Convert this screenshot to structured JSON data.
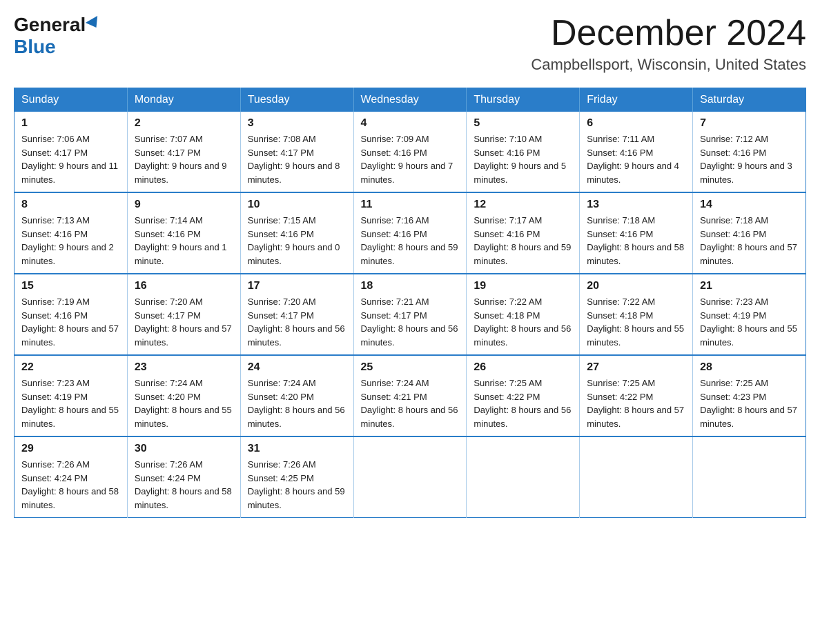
{
  "logo": {
    "general": "General",
    "blue": "Blue"
  },
  "header": {
    "month": "December 2024",
    "location": "Campbellsport, Wisconsin, United States"
  },
  "weekdays": [
    "Sunday",
    "Monday",
    "Tuesday",
    "Wednesday",
    "Thursday",
    "Friday",
    "Saturday"
  ],
  "weeks": [
    [
      {
        "day": "1",
        "sunrise": "7:06 AM",
        "sunset": "4:17 PM",
        "daylight": "9 hours and 11 minutes."
      },
      {
        "day": "2",
        "sunrise": "7:07 AM",
        "sunset": "4:17 PM",
        "daylight": "9 hours and 9 minutes."
      },
      {
        "day": "3",
        "sunrise": "7:08 AM",
        "sunset": "4:17 PM",
        "daylight": "9 hours and 8 minutes."
      },
      {
        "day": "4",
        "sunrise": "7:09 AM",
        "sunset": "4:16 PM",
        "daylight": "9 hours and 7 minutes."
      },
      {
        "day": "5",
        "sunrise": "7:10 AM",
        "sunset": "4:16 PM",
        "daylight": "9 hours and 5 minutes."
      },
      {
        "day": "6",
        "sunrise": "7:11 AM",
        "sunset": "4:16 PM",
        "daylight": "9 hours and 4 minutes."
      },
      {
        "day": "7",
        "sunrise": "7:12 AM",
        "sunset": "4:16 PM",
        "daylight": "9 hours and 3 minutes."
      }
    ],
    [
      {
        "day": "8",
        "sunrise": "7:13 AM",
        "sunset": "4:16 PM",
        "daylight": "9 hours and 2 minutes."
      },
      {
        "day": "9",
        "sunrise": "7:14 AM",
        "sunset": "4:16 PM",
        "daylight": "9 hours and 1 minute."
      },
      {
        "day": "10",
        "sunrise": "7:15 AM",
        "sunset": "4:16 PM",
        "daylight": "9 hours and 0 minutes."
      },
      {
        "day": "11",
        "sunrise": "7:16 AM",
        "sunset": "4:16 PM",
        "daylight": "8 hours and 59 minutes."
      },
      {
        "day": "12",
        "sunrise": "7:17 AM",
        "sunset": "4:16 PM",
        "daylight": "8 hours and 59 minutes."
      },
      {
        "day": "13",
        "sunrise": "7:18 AM",
        "sunset": "4:16 PM",
        "daylight": "8 hours and 58 minutes."
      },
      {
        "day": "14",
        "sunrise": "7:18 AM",
        "sunset": "4:16 PM",
        "daylight": "8 hours and 57 minutes."
      }
    ],
    [
      {
        "day": "15",
        "sunrise": "7:19 AM",
        "sunset": "4:16 PM",
        "daylight": "8 hours and 57 minutes."
      },
      {
        "day": "16",
        "sunrise": "7:20 AM",
        "sunset": "4:17 PM",
        "daylight": "8 hours and 57 minutes."
      },
      {
        "day": "17",
        "sunrise": "7:20 AM",
        "sunset": "4:17 PM",
        "daylight": "8 hours and 56 minutes."
      },
      {
        "day": "18",
        "sunrise": "7:21 AM",
        "sunset": "4:17 PM",
        "daylight": "8 hours and 56 minutes."
      },
      {
        "day": "19",
        "sunrise": "7:22 AM",
        "sunset": "4:18 PM",
        "daylight": "8 hours and 56 minutes."
      },
      {
        "day": "20",
        "sunrise": "7:22 AM",
        "sunset": "4:18 PM",
        "daylight": "8 hours and 55 minutes."
      },
      {
        "day": "21",
        "sunrise": "7:23 AM",
        "sunset": "4:19 PM",
        "daylight": "8 hours and 55 minutes."
      }
    ],
    [
      {
        "day": "22",
        "sunrise": "7:23 AM",
        "sunset": "4:19 PM",
        "daylight": "8 hours and 55 minutes."
      },
      {
        "day": "23",
        "sunrise": "7:24 AM",
        "sunset": "4:20 PM",
        "daylight": "8 hours and 55 minutes."
      },
      {
        "day": "24",
        "sunrise": "7:24 AM",
        "sunset": "4:20 PM",
        "daylight": "8 hours and 56 minutes."
      },
      {
        "day": "25",
        "sunrise": "7:24 AM",
        "sunset": "4:21 PM",
        "daylight": "8 hours and 56 minutes."
      },
      {
        "day": "26",
        "sunrise": "7:25 AM",
        "sunset": "4:22 PM",
        "daylight": "8 hours and 56 minutes."
      },
      {
        "day": "27",
        "sunrise": "7:25 AM",
        "sunset": "4:22 PM",
        "daylight": "8 hours and 57 minutes."
      },
      {
        "day": "28",
        "sunrise": "7:25 AM",
        "sunset": "4:23 PM",
        "daylight": "8 hours and 57 minutes."
      }
    ],
    [
      {
        "day": "29",
        "sunrise": "7:26 AM",
        "sunset": "4:24 PM",
        "daylight": "8 hours and 58 minutes."
      },
      {
        "day": "30",
        "sunrise": "7:26 AM",
        "sunset": "4:24 PM",
        "daylight": "8 hours and 58 minutes."
      },
      {
        "day": "31",
        "sunrise": "7:26 AM",
        "sunset": "4:25 PM",
        "daylight": "8 hours and 59 minutes."
      },
      null,
      null,
      null,
      null
    ]
  ],
  "labels": {
    "sunrise": "Sunrise:",
    "sunset": "Sunset:",
    "daylight": "Daylight:"
  }
}
